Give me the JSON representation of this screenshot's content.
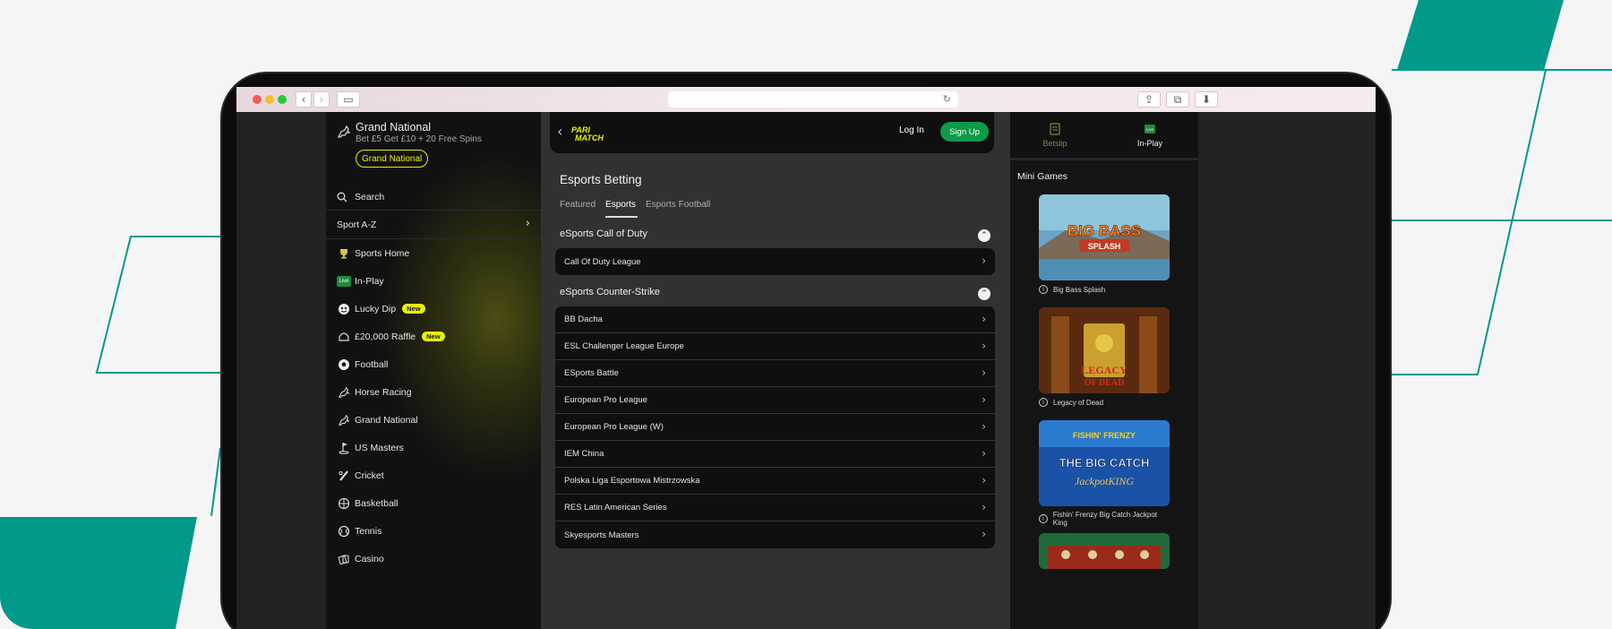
{
  "colors": {
    "teal": "#00998a",
    "brand_yellow": "#e9f400",
    "signup_green": "#0d9a4a",
    "page_bg": "#f5f5f5"
  },
  "browser": {
    "traffic_lights": [
      "#ee5f57",
      "#f5bc2f",
      "#27c840"
    ]
  },
  "promo": {
    "icon": "horse-racing-icon",
    "title": "Grand National",
    "subtitle": "Bet £5 Get £10 + 20 Free Spins",
    "button": "Grand National"
  },
  "sidebar": {
    "search_label": "Search",
    "sport_az_label": "Sport A-Z",
    "items": [
      {
        "icon": "trophy-icon",
        "label": "Sports Home",
        "badge": ""
      },
      {
        "icon": "live-icon",
        "label": "In-Play",
        "badge": ""
      },
      {
        "icon": "lucky-dip-icon",
        "label": "Lucky Dip",
        "badge": "New"
      },
      {
        "icon": "raffle-icon",
        "label": "£20,000 Raffle",
        "badge": "New"
      },
      {
        "icon": "football-icon",
        "label": "Football",
        "badge": ""
      },
      {
        "icon": "horse-racing-icon",
        "label": "Horse Racing",
        "badge": ""
      },
      {
        "icon": "horse-racing-icon",
        "label": "Grand National",
        "badge": ""
      },
      {
        "icon": "golf-icon",
        "label": "US Masters",
        "badge": ""
      },
      {
        "icon": "cricket-icon",
        "label": "Cricket",
        "badge": ""
      },
      {
        "icon": "basketball-icon",
        "label": "Basketball",
        "badge": ""
      },
      {
        "icon": "tennis-icon",
        "label": "Tennis",
        "badge": ""
      },
      {
        "icon": "casino-icon",
        "label": "Casino",
        "badge": ""
      }
    ]
  },
  "header": {
    "logo_text_1": "PARI",
    "logo_text_2": "MATCH",
    "login_label": "Log In",
    "signup_label": "Sign Up"
  },
  "main": {
    "title": "Esports Betting",
    "tabs": [
      {
        "label": "Featured",
        "active": false
      },
      {
        "label": "Esports",
        "active": true
      },
      {
        "label": "Esports Football",
        "active": false
      }
    ],
    "sections": [
      {
        "title": "eSports Call of Duty",
        "rows": [
          "Call Of Duty League"
        ]
      },
      {
        "title": "eSports Counter-Strike",
        "rows": [
          "BB Dacha",
          "ESL Challenger League Europe",
          "ESports Battle",
          "European Pro League",
          "European Pro League (W)",
          "IEM China",
          "Polska Liga Esportowa Mistrzowska",
          "RES Latin American Series",
          "Skyesports Masters"
        ]
      }
    ]
  },
  "right_panel": {
    "betslip_label": "Betslip",
    "inplay_label": "In-Play",
    "mini_games_title": "Mini Games",
    "games": [
      {
        "name": "Big Bass Splash",
        "thumb_text_1": "BIG BASS",
        "thumb_text_2": "SPLASH"
      },
      {
        "name": "Legacy of Dead",
        "thumb_text_1": "LEGACY",
        "thumb_text_2": "OF DEAD"
      },
      {
        "name": "Fishin' Frenzy Big Catch Jackpot King",
        "thumb_text_1": "FISHIN' FRENZY",
        "thumb_text_2": "THE BIG CATCH",
        "thumb_text_3": "JackpotKING"
      }
    ]
  }
}
